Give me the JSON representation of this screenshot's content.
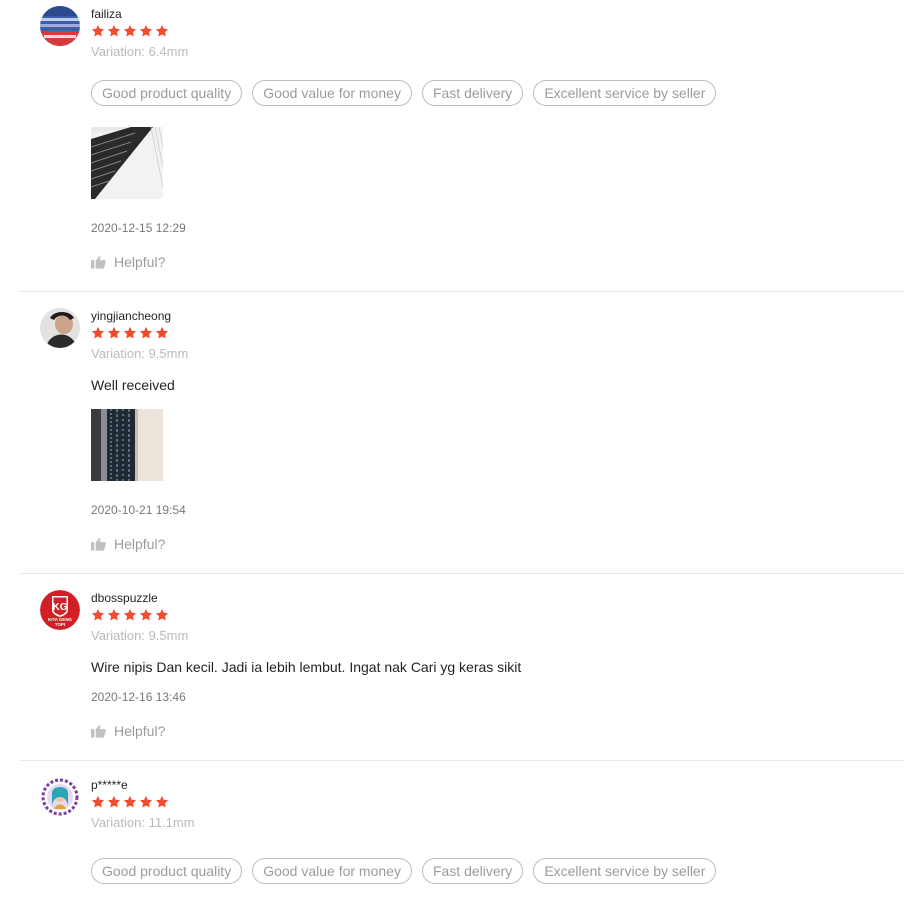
{
  "colors": {
    "star": "#ee4d2d",
    "divider": "#e8e8e8",
    "muted_text": "#b8b8b8"
  },
  "reviews": [
    {
      "author": "failiza",
      "rating": 5,
      "variation": "Variation: 6.4mm",
      "comment": "",
      "tags": [
        "Good product quality",
        "Good value for money",
        "Fast delivery",
        "Excellent service by seller"
      ],
      "has_media": true,
      "timestamp": "2020-12-15 12:29",
      "helpful_label": "Helpful?"
    },
    {
      "author": "yingjiancheong",
      "rating": 5,
      "variation": "Variation: 9.5mm",
      "comment": "Well received",
      "tags": [],
      "has_media": true,
      "timestamp": "2020-10-21 19:54",
      "helpful_label": "Helpful?"
    },
    {
      "author": "dbosspuzzle",
      "avatar_logo_text": [
        "KG",
        "KITA GENG",
        "TOPI"
      ],
      "rating": 5,
      "variation": "Variation: 9.5mm",
      "comment": "Wire nipis Dan kecil. Jadi ia lebih lembut. Ingat nak Cari yg keras sikit",
      "tags": [],
      "has_media": false,
      "timestamp": "2020-12-16 13:46",
      "helpful_label": "Helpful?"
    },
    {
      "author": "p*****e",
      "rating": 5,
      "variation": "Variation: 11.1mm",
      "comment": "",
      "tags": [
        "Good product quality",
        "Good value for money",
        "Fast delivery",
        "Excellent service by seller"
      ],
      "has_media": false,
      "timestamp": "",
      "helpful_label": ""
    }
  ]
}
